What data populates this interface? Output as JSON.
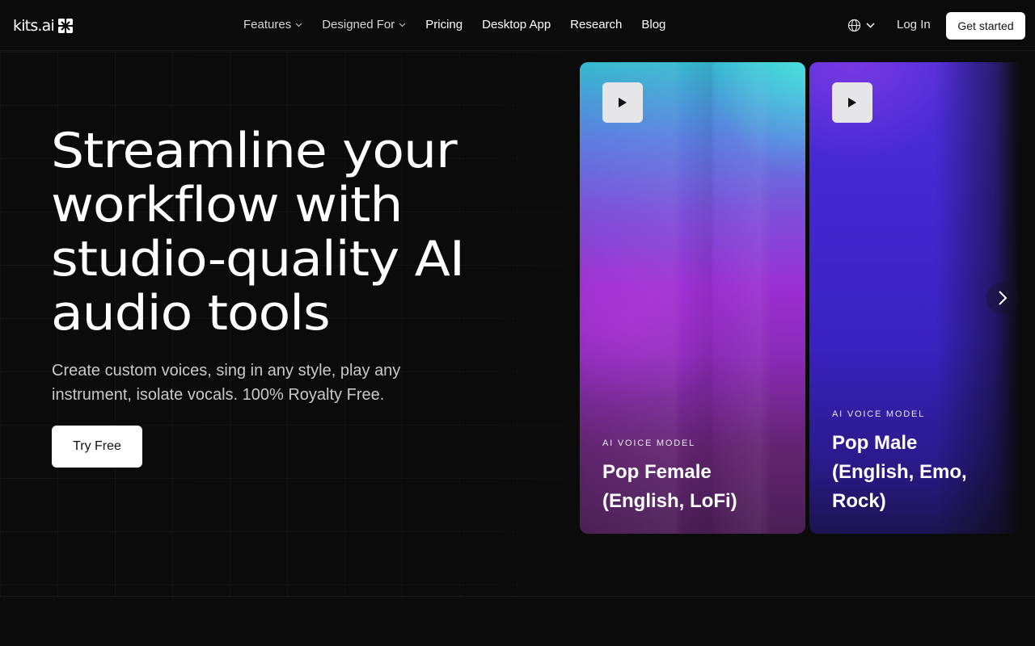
{
  "header": {
    "logo_text": "kits.ai",
    "nav": [
      {
        "label": "Features",
        "dropdown": true
      },
      {
        "label": "Designed For",
        "dropdown": true
      },
      {
        "label": "Pricing",
        "dropdown": false
      },
      {
        "label": "Desktop App",
        "dropdown": false
      },
      {
        "label": "Research",
        "dropdown": false
      },
      {
        "label": "Blog",
        "dropdown": false
      }
    ],
    "language_icon": "globe-icon",
    "login_label": "Log In",
    "cta_label": "Get started"
  },
  "hero": {
    "title_lines": [
      "Streamline your",
      "workflow with",
      "studio-quality AI",
      "audio tools"
    ],
    "subtitle_lines": [
      "Create custom voices, sing in any style, play any",
      "instrument, isolate vocals. 100% Royalty Free."
    ],
    "cta_label": "Try Free"
  },
  "cards": [
    {
      "kicker": "AI VOICE MODEL",
      "title_lines": [
        "Pop Female",
        "(English, LoFi)"
      ],
      "icon": "play-icon"
    },
    {
      "kicker": "AI VOICE MODEL",
      "title_lines": [
        "Pop Male",
        "(English, Emo,",
        "Rock)"
      ],
      "icon": "play-icon"
    }
  ],
  "carousel": {
    "next_icon": "chevron-right-icon"
  },
  "colors": {
    "background": "#0b0b0c",
    "button_bg": "#ffffff",
    "text": "#ffffff",
    "muted_text": "#c9c9c9"
  }
}
